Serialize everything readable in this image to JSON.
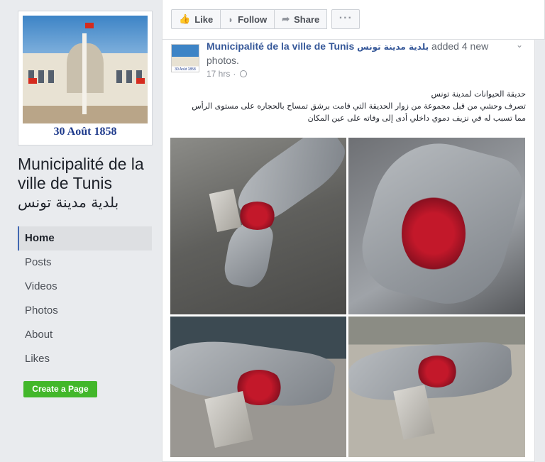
{
  "page": {
    "name": "Municipalité de la ville de Tunis",
    "name_arabic": "بلدية مدينة تونس",
    "cover_caption": "30 Août 1858"
  },
  "nav": {
    "items": [
      {
        "label": "Home",
        "active": true
      },
      {
        "label": "Posts"
      },
      {
        "label": "Videos"
      },
      {
        "label": "Photos"
      },
      {
        "label": "About"
      },
      {
        "label": "Likes"
      }
    ]
  },
  "create_page": {
    "label": "Create a Page"
  },
  "actions": {
    "like": "Like",
    "follow": "Follow",
    "share": "Share",
    "more": "···"
  },
  "post": {
    "author": "Municipalité de la ville de Tunis",
    "author_arabic": "بلدية مدينة تونس",
    "action": "added 4 new photos.",
    "time": "17 hrs",
    "avatar_caption": "30 Août 1858",
    "text_lines": [
      "حديقة الحيوانات لمدينة تونس",
      "تصرف وحشي من قبل مجموعة من زوار الحديقة التي قامت برشق تمساح بالحجاره على مستوى الرأس",
      "مما تسبب له في نزيف دموي داخلي أدى إلى وفاته على عين المكان"
    ],
    "photo_count": 4
  },
  "colors": {
    "link": "#365899",
    "create_button": "#42b72a",
    "active_border": "#4267b2",
    "background": "#e9ebee"
  },
  "icons": {
    "like": "thumbs-up-icon",
    "follow": "rss-icon",
    "share": "share-arrow-icon",
    "privacy": "globe-icon",
    "options": "chevron-down-icon"
  }
}
